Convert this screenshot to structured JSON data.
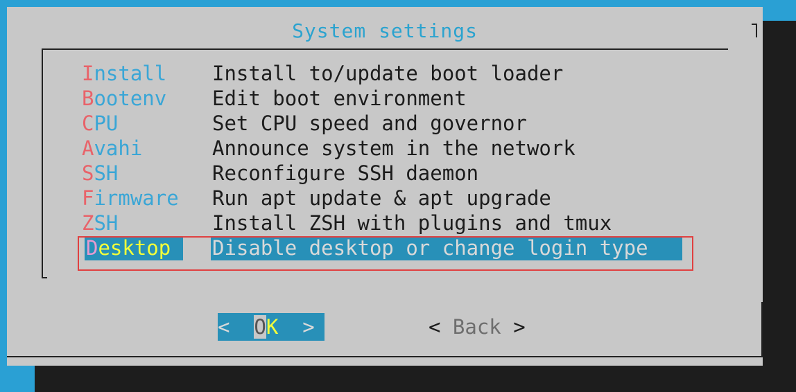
{
  "dialog": {
    "title": "System settings"
  },
  "menu": {
    "items": [
      {
        "hot": "I",
        "rest": "nstall",
        "desc": "Install to/update boot loader"
      },
      {
        "hot": "B",
        "rest": "ootenv",
        "desc": "Edit boot environment"
      },
      {
        "hot": "C",
        "rest": "PU",
        "desc": "Set CPU speed and governor"
      },
      {
        "hot": "A",
        "rest": "vahi",
        "desc": "Announce system in the network"
      },
      {
        "hot": "S",
        "rest": "SH",
        "desc": "Reconfigure SSH daemon"
      },
      {
        "hot": "F",
        "rest": "irmware",
        "desc": "Run apt update & apt upgrade"
      },
      {
        "hot": "Z",
        "rest": "SH",
        "desc": "Install ZSH with plugins and tmux"
      },
      {
        "hot": "D",
        "rest": "esktop",
        "desc": "Disable desktop or change login type"
      }
    ],
    "selected_index": 7
  },
  "buttons": {
    "ok": {
      "left": "<  ",
      "o": "O",
      "k": "K",
      "right": "  >"
    },
    "back": {
      "left": "< ",
      "b": "B",
      "rest": "ack",
      "right": " >"
    }
  },
  "colors": {
    "background": "#2aa0d4",
    "dialog": "#c8c8c8",
    "shadow": "#1d1d1d",
    "selection": "#2890b8",
    "hotkey": "#e8636a",
    "highlight_box": "#e04040"
  }
}
